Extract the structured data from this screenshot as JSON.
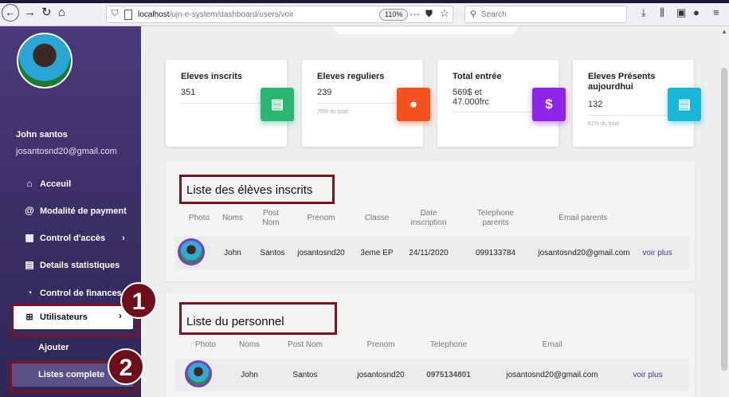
{
  "browser": {
    "url_prefix": "localhost",
    "url_path": "/ujn-e-system/dashboard/users/voir",
    "zoom": "110%",
    "search_placeholder": "Search"
  },
  "sidebar": {
    "user_name": "John santos",
    "user_email": "josantosnd20@gmail.com",
    "items": [
      {
        "label": "Acceuil",
        "icon": "home-icon"
      },
      {
        "label": "Modalité de payment",
        "icon": "at-sign-icon"
      },
      {
        "label": "Control d'accès",
        "icon": "grid-icon",
        "chevron": "›"
      },
      {
        "label": "Details statistiques",
        "icon": "table-icon"
      },
      {
        "label": "Control de finances",
        "icon": "pie-icon"
      }
    ],
    "active_item": {
      "label": "Utilisateurs",
      "icon": "users-icon",
      "chevron": "›"
    },
    "submenu": [
      "Ajouter",
      "Listes complete"
    ]
  },
  "annotations": {
    "badge1": "1",
    "badge2": "2"
  },
  "stats": [
    {
      "title": "Eleves inscrits",
      "value": "351",
      "sub": "",
      "color": "#2bb673",
      "icon": "list-icon"
    },
    {
      "title": "Eleves reguliers",
      "value": "239",
      "sub": "75% du total",
      "color": "#f4511e",
      "icon": "user-circle-icon"
    },
    {
      "title": "Total entrée",
      "value": "569$ et 47.000frc",
      "sub": "",
      "color": "#8e24e8",
      "icon": "dollar-icon"
    },
    {
      "title": "Eleves Présents aujourdhui",
      "value": "132",
      "sub": "61% du total",
      "color": "#1ab6d8",
      "icon": "document-icon"
    }
  ],
  "students": {
    "title": "Liste des élèves inscrits",
    "headers": [
      "Photo",
      "Noms",
      "Post Nom",
      "Prenom",
      "Classe",
      "Date inscription",
      "Telephone parents",
      "Email parents"
    ],
    "rows": [
      {
        "nom": "John",
        "postnom": "Santos",
        "prenom": "josantosnd20",
        "classe": "3eme EP",
        "date": "24/11/2020",
        "tel": "099133784",
        "email": "josantosnd20@gmail.com",
        "action": "voir plus"
      }
    ]
  },
  "staff": {
    "title": "Liste du personnel",
    "headers": [
      "Photo",
      "Noms",
      "Post Nom",
      "Prenom",
      "Telephone",
      "Email"
    ],
    "rows": [
      {
        "nom": "John",
        "postnom": "Santos",
        "prenom": "josantosnd20",
        "tel": "0975134801",
        "email": "josantosnd20@gmail.com",
        "action": "voir plus"
      }
    ]
  }
}
